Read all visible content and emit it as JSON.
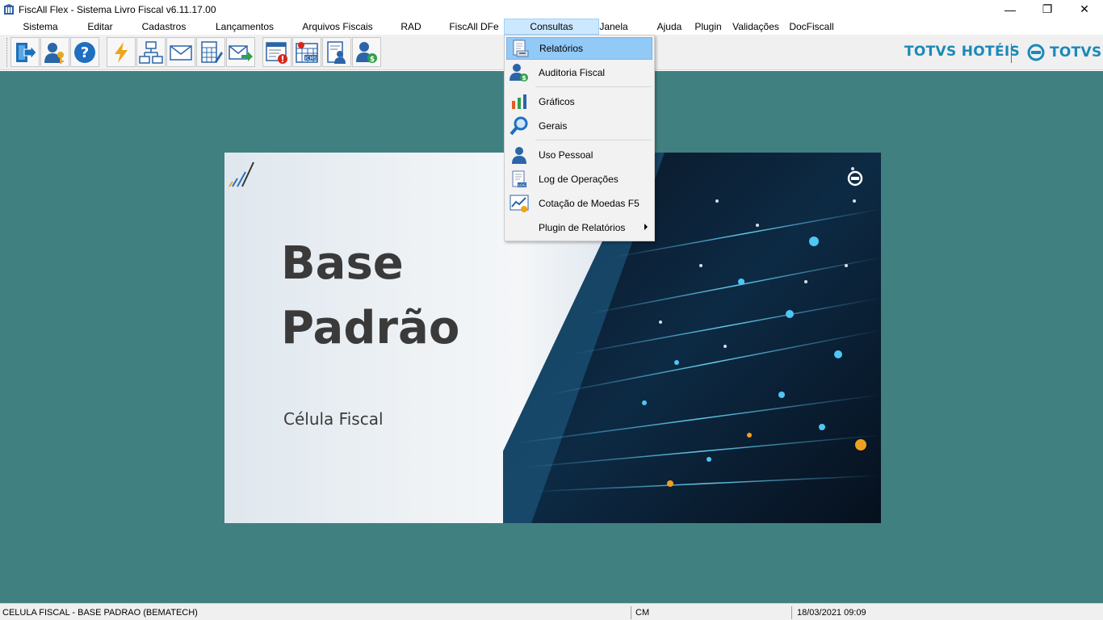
{
  "window": {
    "title": "FiscAll Flex - Sistema Livro Fiscal v6.11.17.00",
    "controls": {
      "minimize": "—",
      "restore": "❐",
      "close": "✕"
    }
  },
  "menu": [
    {
      "label": "Sistema"
    },
    {
      "label": "Editar"
    },
    {
      "label": "Cadastros"
    },
    {
      "label": "Lançamentos"
    },
    {
      "label": "Arquivos Fiscais"
    },
    {
      "label": "RAD"
    },
    {
      "label": "FiscAll DFe"
    },
    {
      "label": "Consultas",
      "active": true
    },
    {
      "label": "Janela"
    },
    {
      "label": "Ajuda"
    },
    {
      "label": "Plugin"
    },
    {
      "label": "Validações"
    },
    {
      "label": "DocFiscall"
    }
  ],
  "toolbar": {
    "buttons": [
      {
        "icon": "exit-icon"
      },
      {
        "icon": "user-key-icon"
      },
      {
        "icon": "help-icon"
      },
      {
        "icon": "lightning-icon"
      },
      {
        "icon": "network-icon"
      },
      {
        "icon": "mail-icon"
      },
      {
        "icon": "calculator-icon"
      },
      {
        "icon": "mail-send-icon"
      },
      {
        "icon": "alert-window-icon"
      },
      {
        "icon": "icms-calendar-icon"
      },
      {
        "icon": "user-report-icon"
      },
      {
        "icon": "user-money-icon"
      }
    ]
  },
  "branding": {
    "left": "TOTVS HOTÉIS",
    "right": "TOTVS"
  },
  "splash": {
    "title_line1": "Base",
    "title_line2": "Padrão",
    "subtitle": "Célula Fiscal"
  },
  "dropdown": {
    "items": [
      {
        "label": "Relatórios",
        "icon": "report-icon",
        "highlighted": true
      },
      {
        "label": "Auditoria Fiscal",
        "icon": "audit-icon"
      },
      {
        "label": "Gráficos",
        "icon": "chart-icon"
      },
      {
        "label": "Gerais",
        "icon": "magnifier-icon"
      },
      {
        "label": "Uso Pessoal",
        "icon": "person-icon"
      },
      {
        "label": "Log de Operações",
        "icon": "log-icon"
      },
      {
        "label": "Cotação de Moedas F5",
        "icon": "currency-chart-icon"
      },
      {
        "label": "Plugin de Relatórios",
        "icon": "",
        "submenu": true
      }
    ]
  },
  "statusbar": {
    "company": "CELULA FISCAL - BASE PADRAO (BEMATECH)",
    "mode": "CM",
    "datetime": "18/03/2021 09:09"
  },
  "colors": {
    "workspace": "#418080",
    "menu_active": "#cce8ff",
    "dropdown_highlight": "#91c9f7",
    "brand": "#1a8ab8"
  }
}
